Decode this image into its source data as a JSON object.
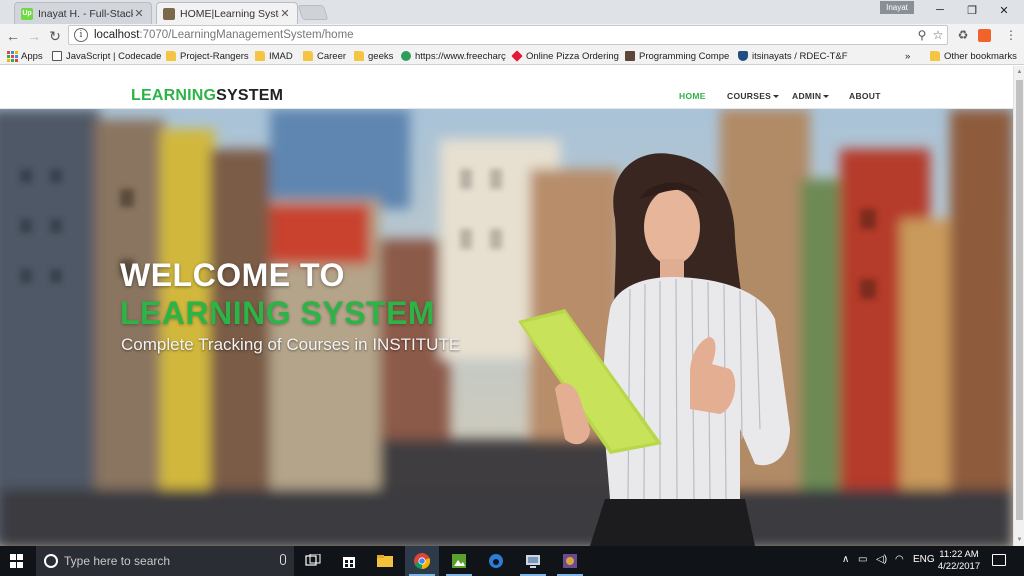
{
  "browser": {
    "tabs": [
      {
        "title": "Inayat H. - Full-Stack We",
        "favicon_text": "Up",
        "favicon_color": "#6fda44"
      },
      {
        "title": "HOME|Learning System",
        "favicon_text": "",
        "favicon_color": "#7a6a4a"
      }
    ],
    "profile_name": "Inayat",
    "window_controls": {
      "minimize": "─",
      "restore": "❐",
      "close": "✕"
    },
    "url_host": "localhost",
    "url_path": ":7070/LearningManagementSystem/home",
    "bookmarks": [
      {
        "label": "Apps",
        "icon": "apps-icon"
      },
      {
        "label": "JavaScript | Codecade",
        "icon": "page-icon"
      },
      {
        "label": "Project-Rangers",
        "icon": "folder-icon"
      },
      {
        "label": "IMAD",
        "icon": "folder-icon"
      },
      {
        "label": "Career",
        "icon": "folder-icon"
      },
      {
        "label": "geeks",
        "icon": "folder-icon"
      },
      {
        "label": "https://www.freecharç",
        "icon": "freecharge-icon"
      },
      {
        "label": "Online Pizza Ordering",
        "icon": "dominos-icon"
      },
      {
        "label": "Programming Compe",
        "icon": "codechef-icon"
      },
      {
        "label": "itsinayats / RDEC-T&F",
        "icon": "bitbucket-icon"
      }
    ],
    "more_bookmarks": "»",
    "other_bookmarks": "Other bookmarks"
  },
  "site": {
    "brand_part1": "LEARNING",
    "brand_part2": "SYSTEM",
    "nav": [
      {
        "label": "HOME",
        "active": true,
        "dropdown": false
      },
      {
        "label": "COURSES",
        "active": false,
        "dropdown": true
      },
      {
        "label": "ADMIN",
        "active": false,
        "dropdown": true
      },
      {
        "label": "ABOUT",
        "active": false,
        "dropdown": false
      }
    ],
    "hero": {
      "line1": "WELCOME TO",
      "line2": "LEARNING SYSTEM",
      "subtitle": "Complete Tracking of Courses in INSTITUTE"
    },
    "colors": {
      "accent": "#2db447"
    }
  },
  "taskbar": {
    "search_placeholder": "Type here to search",
    "language": "ENG",
    "time": "11:22 AM",
    "date": "4/22/2017"
  }
}
